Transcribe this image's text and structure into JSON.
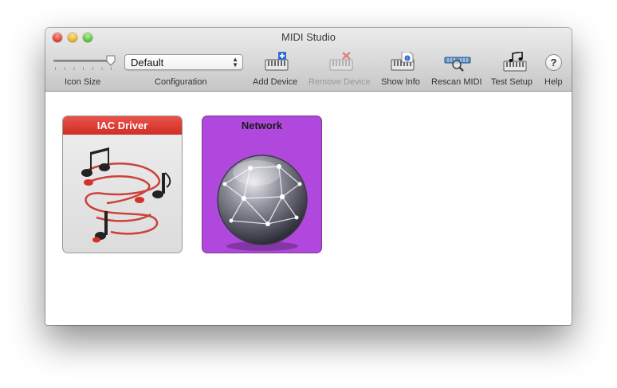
{
  "window": {
    "title": "MIDI Studio"
  },
  "toolbar": {
    "icon_size_label": "Icon Size",
    "configuration_label": "Configuration",
    "configuration_value": "Default",
    "add_device_label": "Add Device",
    "remove_device_label": "Remove Device",
    "show_info_label": "Show Info",
    "rescan_midi_label": "Rescan MIDI",
    "test_setup_label": "Test Setup",
    "help_label": "Help",
    "help_glyph": "?"
  },
  "devices": [
    {
      "name": "IAC Driver",
      "icon": "music-notes-icon"
    },
    {
      "name": "Network",
      "icon": "network-globe-icon"
    }
  ],
  "colors": {
    "iac_header": "#d9372f",
    "network_card": "#b148dd"
  }
}
